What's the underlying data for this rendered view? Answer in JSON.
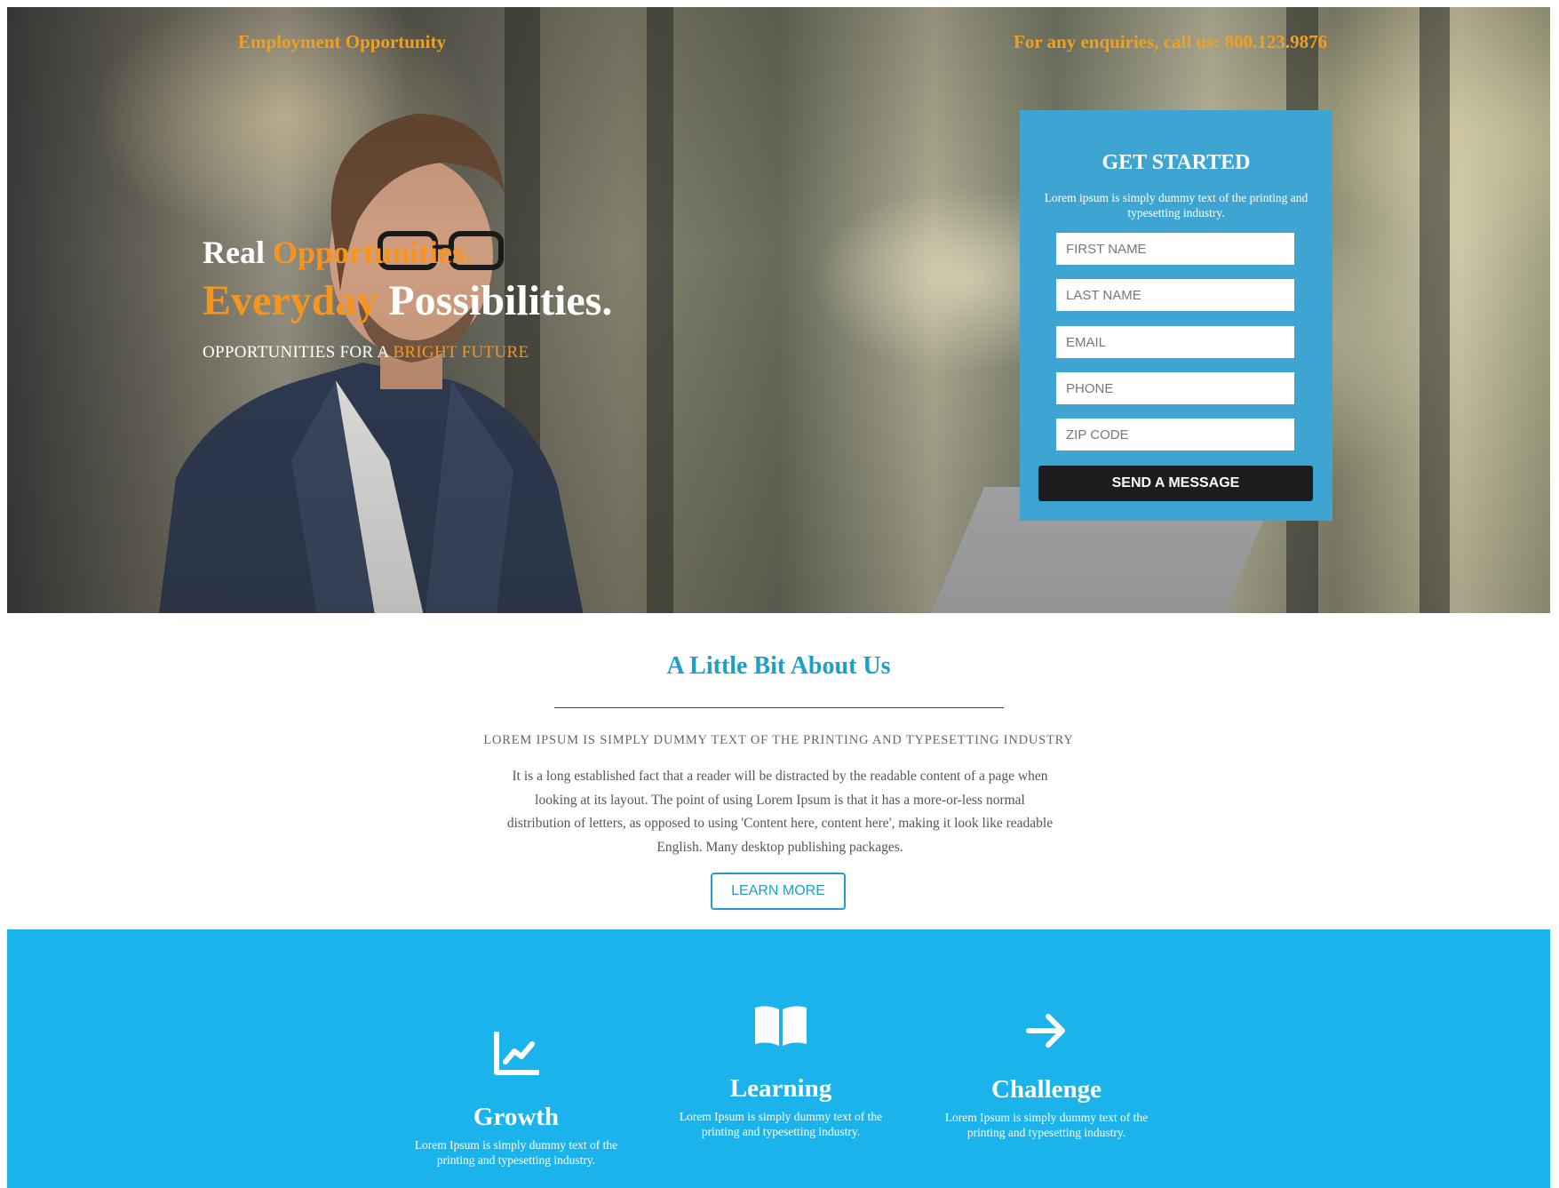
{
  "header": {
    "title": "Employment Opportunity",
    "contact": "For any enquiries, call us: 800.123.9876"
  },
  "hero": {
    "line1_a": "Real ",
    "line1_b": "Opportunities.",
    "line2_a": "Everyday ",
    "line2_b": "Possibilities.",
    "sub_a": "OPPORTUNITIES FOR A ",
    "sub_b": "BRIGHT FUTURE"
  },
  "form": {
    "title": "GET STARTED",
    "description": "Lorem ipsum is simply dummy text of the printing and typesetting industry.",
    "fields": {
      "first_name": "FIRST NAME",
      "last_name": "LAST NAME",
      "email": "EMAIL",
      "phone": "PHONE",
      "zip": "ZIP CODE"
    },
    "submit_label": "SEND A MESSAGE"
  },
  "about": {
    "title": "A Little Bit About Us",
    "subtitle": "LOREM IPSUM IS SIMPLY DUMMY TEXT OF THE PRINTING AND TYPESETTING INDUSTRY",
    "body": "It is a long established fact that a reader will be distracted by the readable content of a page when looking at its layout. The point of using Lorem Ipsum is that it has a more-or-less normal distribution of letters, as opposed to using 'Content here, content here', making it look like readable English. Many desktop publishing packages.",
    "button_label": "LEARN MORE"
  },
  "features": [
    {
      "icon": "line-chart-icon",
      "title": "Growth",
      "text": "Lorem Ipsum is simply dummy text of the printing and typesetting industry."
    },
    {
      "icon": "open-book-icon",
      "title": "Learning",
      "text": "Lorem Ipsum is simply dummy text of the printing and typesetting industry."
    },
    {
      "icon": "arrow-right-icon",
      "title": "Challenge",
      "text": "Lorem Ipsum is simply dummy text of the printing and typesetting industry."
    }
  ],
  "colors": {
    "accent_orange": "#f7941d",
    "form_blue": "#3ea5d2",
    "title_blue": "#1e9fc9",
    "feature_band": "#1bb3ec",
    "button_dark": "#1d1d1f"
  }
}
